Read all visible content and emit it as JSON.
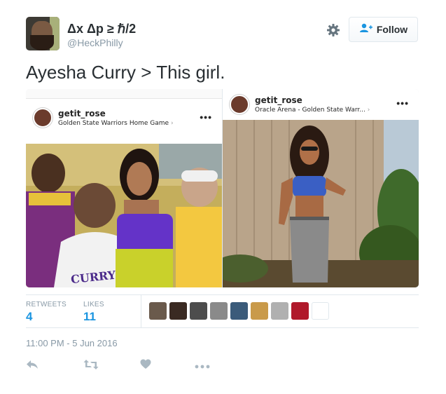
{
  "user": {
    "display_name": "Δx Δp ≥ ℏ/2",
    "handle": "@HeckPhilly"
  },
  "follow_button": {
    "label": "Follow"
  },
  "tweet": {
    "text": "Ayesha Curry > This girl."
  },
  "media": {
    "left": {
      "username": "getit_rose",
      "location": "Golden State Warriors Home Game",
      "more": "•••",
      "jersey_text": "CURRY"
    },
    "right": {
      "username": "getit_rose",
      "location": "Oracle Arena - Golden State Warr...",
      "more": "•••"
    }
  },
  "stats": {
    "retweets_label": "RETWEETS",
    "retweets_value": "4",
    "likes_label": "LIKES",
    "likes_value": "11"
  },
  "likers": [
    "#6a5a4c",
    "#3a2a22",
    "#4d4d4d",
    "#8a8a8a",
    "#3b5b7a",
    "#c99a4a",
    "#b0b0b0",
    "#b0192b",
    "#ffffff"
  ],
  "timestamp": "11:00 PM - 5 Jun 2016",
  "colors": {
    "link": "#1b95e0",
    "muted": "#8899a6",
    "text": "#292f33"
  },
  "icons": [
    "gear-icon",
    "follow-plus-icon",
    "reply-icon",
    "retweet-icon",
    "like-icon",
    "more-icon"
  ]
}
